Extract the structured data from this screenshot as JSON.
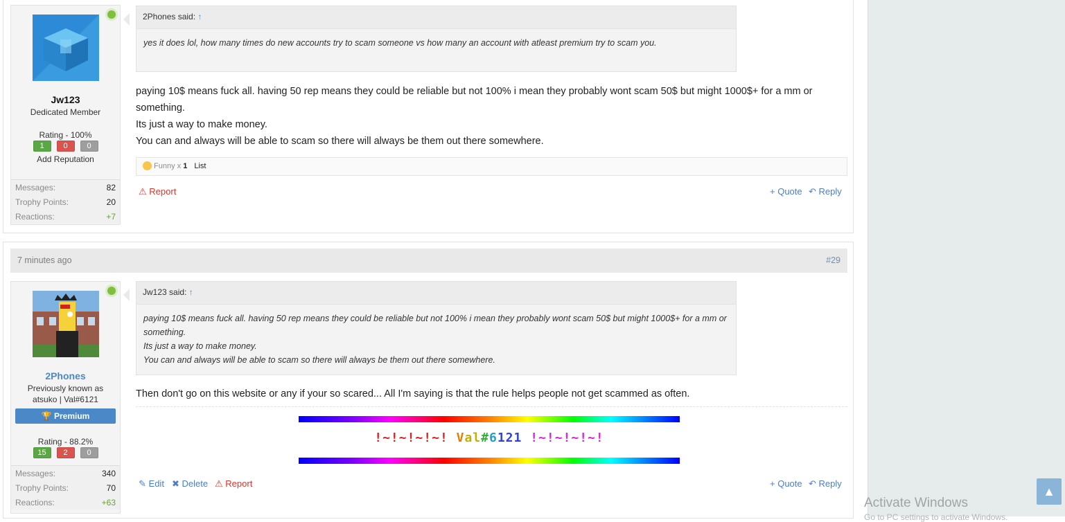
{
  "post1": {
    "user": {
      "name": "Jw123",
      "title": "Dedicated Member",
      "rating_label": "Rating - 100%",
      "ratings": [
        "1",
        "0",
        "0"
      ],
      "add_rep": "Add Reputation",
      "stats": [
        {
          "k": "Messages:",
          "v": "82"
        },
        {
          "k": "Trophy Points:",
          "v": "20"
        },
        {
          "k": "Reactions:",
          "v": "+7"
        }
      ]
    },
    "quote": {
      "author": "2Phones said: ",
      "arrow": "↑",
      "text": "yes it does lol, how many times do new accounts try to scam someone vs how many an account with atleast premium try to scam you."
    },
    "message": [
      "paying 10$ means fuck all. having 50 rep means they could be reliable but not 100% i mean they probably wont scam 50$ but might 1000$+ for a mm or something.",
      "Its just a way to make money.",
      "You can and always will be able to scam so there will always be them out there somewhere."
    ],
    "reactions": {
      "label": "Funny x ",
      "count": "1",
      "list": "List"
    },
    "actions": {
      "report": "Report",
      "quote": "+ Quote",
      "reply": "Reply"
    }
  },
  "post2": {
    "time": "7 minutes ago",
    "number": "#29",
    "user": {
      "name": "2Phones",
      "title": "Previously known as atsuko | Val#6121",
      "premium": "Premium",
      "rating_label": "Rating - 88.2%",
      "ratings": [
        "15",
        "2",
        "0"
      ],
      "stats": [
        {
          "k": "Messages:",
          "v": "340"
        },
        {
          "k": "Trophy Points:",
          "v": "70"
        },
        {
          "k": "Reactions:",
          "v": "+63"
        }
      ]
    },
    "quote": {
      "author": "Jw123 said: ",
      "arrow": "↑",
      "lines": [
        "paying 10$ means fuck all. having 50 rep means they could be reliable but not 100% i mean they probably wont scam 50$ but might 1000$+ for a mm or something.",
        "Its just a way to make money.",
        "You can and always will be able to scam so there will always be them out there somewhere."
      ]
    },
    "message": "Then don't go on this website or any if your so scared... All I'm saying is that the rule helps people not get scammed as often.",
    "signature": {
      "segments": [
        {
          "t": "!~!~!~!~! ",
          "c": "#e02020"
        },
        {
          "t": "V",
          "c": "#e08000"
        },
        {
          "t": "al",
          "c": "#c0b000"
        },
        {
          "t": "#",
          "c": "#30b030"
        },
        {
          "t": "6",
          "c": "#20a0d0"
        },
        {
          "t": "121",
          "c": "#3040e0"
        },
        {
          "t": " !~!~!~!~!",
          "c": "#e020e0"
        }
      ]
    },
    "actions": {
      "edit": "Edit",
      "delete": "Delete",
      "report": "Report",
      "quote": "+ Quote",
      "reply": "Reply"
    }
  },
  "overlay": {
    "activate": "Activate Windows",
    "activate_sub": "Go to PC settings to activate Windows."
  },
  "colors": {
    "green": "#5aa844",
    "red": "#d9534f",
    "gray": "#9e9e9e",
    "premium": "#4a88c8",
    "link": "#4f7ec0"
  }
}
